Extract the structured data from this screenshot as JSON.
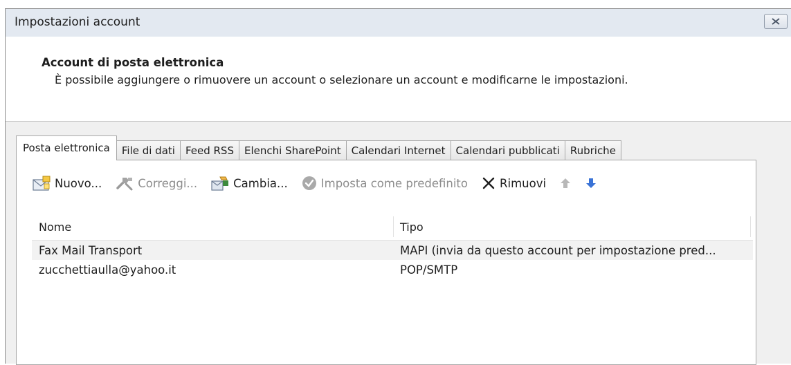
{
  "window": {
    "title": "Impostazioni account"
  },
  "header": {
    "heading": "Account di posta elettronica",
    "description": "È possibile aggiungere o rimuovere un account o selezionare un account e modificarne le impostazioni."
  },
  "tabs": [
    {
      "label": "Posta elettronica",
      "active": true
    },
    {
      "label": "File di dati"
    },
    {
      "label": "Feed RSS"
    },
    {
      "label": "Elenchi SharePoint"
    },
    {
      "label": "Calendari Internet"
    },
    {
      "label": "Calendari pubblicati"
    },
    {
      "label": "Rubriche"
    }
  ],
  "toolbar": {
    "new_label": "Nuovo...",
    "repair_label": "Correggi...",
    "change_label": "Cambia...",
    "default_label": "Imposta come predefinito",
    "remove_label": "Rimuovi"
  },
  "table": {
    "columns": [
      "Nome",
      "Tipo"
    ],
    "rows": [
      {
        "name": "Fax Mail Transport",
        "type": "MAPI (invia da questo account per impostazione pred...",
        "selected": true
      },
      {
        "name": "zucchettiaulla@yahoo.it",
        "type": "POP/SMTP"
      }
    ]
  }
}
